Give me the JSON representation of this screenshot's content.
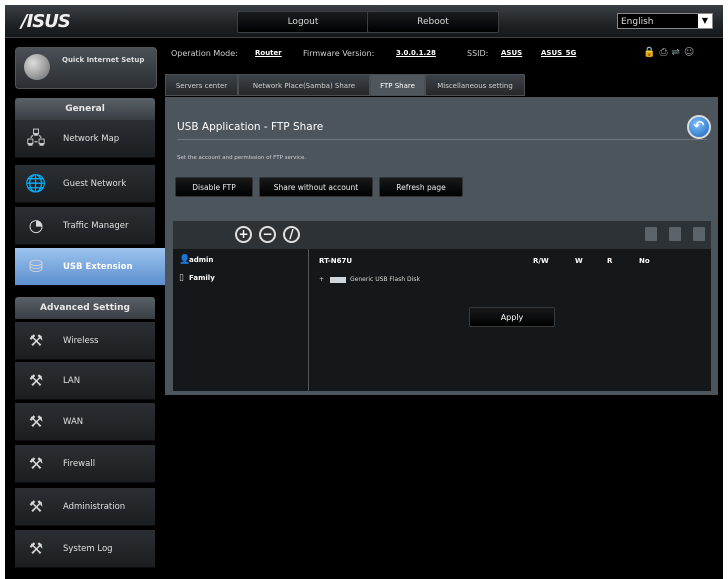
{
  "header": {
    "logo": "/ISUS",
    "logout_label": "Logout",
    "reboot_label": "Reboot",
    "language": "English"
  },
  "sidebar": {
    "quick_setup": "Quick Internet Setup",
    "general_header": "General",
    "general_items": [
      {
        "label": "Network Map",
        "icon": "network-map-icon"
      },
      {
        "label": "Guest Network",
        "icon": "guest-network-icon"
      },
      {
        "label": "Traffic Manager",
        "icon": "traffic-manager-icon"
      },
      {
        "label": "USB Extension",
        "icon": "usb-extension-icon",
        "active": true
      }
    ],
    "advanced_header": "Advanced Setting",
    "advanced_items": [
      {
        "label": "Wireless",
        "icon": "wrench-icon"
      },
      {
        "label": "LAN",
        "icon": "wrench-icon"
      },
      {
        "label": "WAN",
        "icon": "wrench-icon"
      },
      {
        "label": "Firewall",
        "icon": "wrench-icon"
      },
      {
        "label": "Administration",
        "icon": "wrench-icon"
      },
      {
        "label": "System Log",
        "icon": "wrench-icon"
      }
    ]
  },
  "info": {
    "op_mode_label": "Operation Mode:",
    "op_mode_value": "Router",
    "firmware_label": "Firmware Version:",
    "firmware_value": "3.0.0.1.28",
    "ssid_label": "SSID:",
    "ssid_value_1": "ASUS",
    "ssid_value_2": "ASUS_5G"
  },
  "tabs": [
    {
      "label": "Servers center"
    },
    {
      "label": "Network Place(Samba) Share"
    },
    {
      "label": "FTP Share",
      "active": true
    },
    {
      "label": "Miscellaneous setting"
    }
  ],
  "panel": {
    "title": "USB Application - FTP Share",
    "description": "Set the account and permission of FTP service.",
    "buttons": {
      "disable_ftp": "Disable FTP",
      "share_without_account": "Share without account",
      "refresh_page": "Refresh page"
    },
    "accounts": [
      "admin",
      "Family"
    ],
    "device_name": "RT-N67U",
    "permission_headers": [
      "R/W",
      "W",
      "R",
      "No"
    ],
    "drive_label": "Generic USB Flash Disk",
    "apply_label": "Apply"
  }
}
